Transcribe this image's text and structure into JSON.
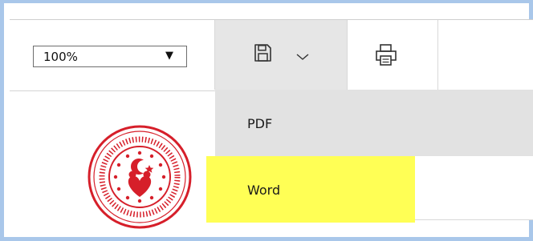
{
  "toolbar": {
    "zoom": {
      "value": "100%",
      "caret": "▼"
    },
    "save_menu": {
      "icon": "floppy-disk-icon",
      "chevron": "chevron-down-icon"
    },
    "print": {
      "icon": "printer-icon"
    }
  },
  "save_dropdown": {
    "items": [
      {
        "label": "PDF"
      },
      {
        "label": "Word",
        "highlighted": true
      }
    ]
  },
  "logo": {
    "icon": "ministry-seal-logo",
    "colors": {
      "primary": "#d61f2a"
    }
  },
  "colors": {
    "frame_border": "#a9c7ea",
    "active_button_bg": "#e6e6e6",
    "menu_hover_bg": "#e2e2e2",
    "highlight": "#ffff55"
  }
}
